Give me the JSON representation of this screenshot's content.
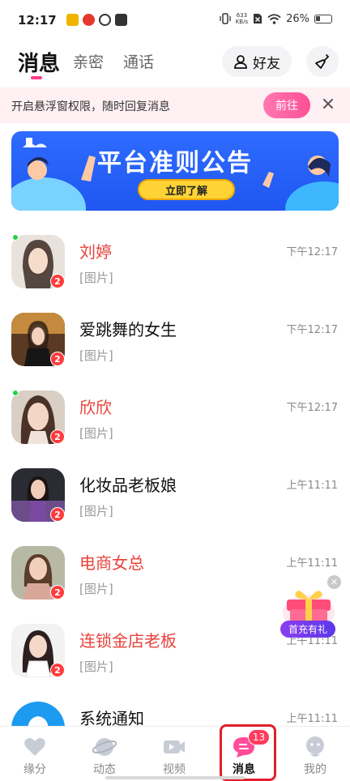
{
  "status_bar": {
    "time": "12:17",
    "net_speed_value": "633",
    "net_speed_unit": "KB/s",
    "battery": "26%"
  },
  "header": {
    "tabs": [
      {
        "label": "消息"
      },
      {
        "label": "亲密"
      },
      {
        "label": "通话"
      }
    ],
    "friends_label": "好友"
  },
  "notice": {
    "text": "开启悬浮窗权限，随时回复消息",
    "button_label": "前往"
  },
  "banner": {
    "title": "平台准则公告",
    "button_label": "立即了解"
  },
  "messages": [
    {
      "name": "刘婷",
      "preview": "[图片]",
      "time": "下午12:17",
      "unread": "2",
      "online": true,
      "vip": true
    },
    {
      "name": "爱跳舞的女生",
      "preview": "[图片]",
      "time": "下午12:17",
      "unread": "2",
      "online": false,
      "vip": false
    },
    {
      "name": "欣欣",
      "preview": "[图片]",
      "time": "下午12:17",
      "unread": "2",
      "online": true,
      "vip": true
    },
    {
      "name": "化妆品老板娘",
      "preview": "[图片]",
      "time": "上午11:11",
      "unread": "2",
      "online": false,
      "vip": false
    },
    {
      "name": "电商女总",
      "preview": "[图片]",
      "time": "上午11:11",
      "unread": "2",
      "online": false,
      "vip": true
    },
    {
      "name": "连锁金店老板",
      "preview": "[图片]",
      "time": "上午11:11",
      "unread": "2",
      "online": false,
      "vip": true
    },
    {
      "name": "系统通知",
      "preview": "",
      "time": "上午11:11",
      "unread": "",
      "online": false,
      "vip": false
    }
  ],
  "gift": {
    "label": "首充有礼"
  },
  "bottom_nav": {
    "items": [
      {
        "label": "缘分"
      },
      {
        "label": "动态"
      },
      {
        "label": "视频"
      },
      {
        "label": "消息"
      },
      {
        "label": "我的"
      }
    ],
    "messages_badge": "13"
  },
  "colors": {
    "accent_pink": "#ff4f96",
    "vip_name_red": "#e8413a",
    "banner_blue": "#2f6bff",
    "badge_red": "#ff3b3b"
  }
}
